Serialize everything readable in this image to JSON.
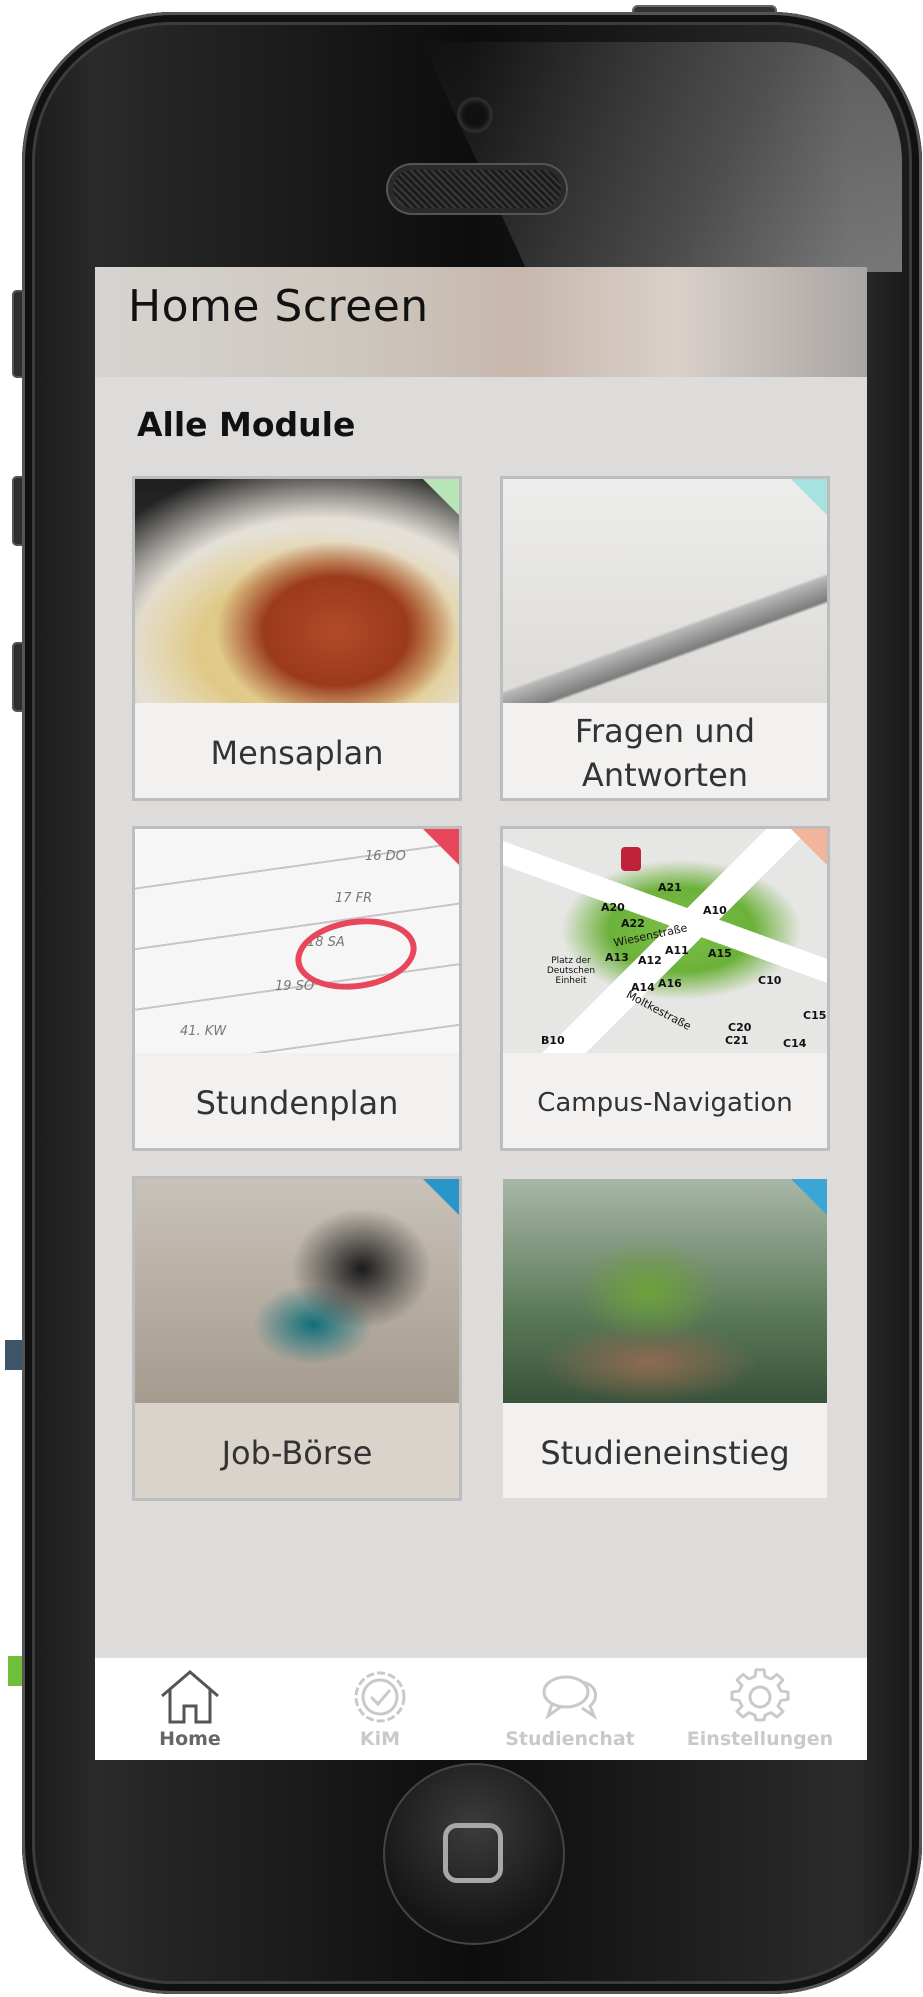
{
  "header": {
    "title": "Home Screen"
  },
  "section": {
    "title": "Alle Module"
  },
  "modules": [
    {
      "label": "Mensaplan",
      "image": "food-photo",
      "accent": "#b9e6b9"
    },
    {
      "label": "Fragen und Antworten",
      "image": "fountain-pen-photo",
      "accent": "#a6e2de"
    },
    {
      "label": "Stundenplan",
      "image": "calendar-photo",
      "accent": "#e8475b"
    },
    {
      "label": "Campus-Navigation",
      "image": "campus-map",
      "accent": "#f0b59a"
    },
    {
      "label": "Job-Börse",
      "image": "handshake-photo",
      "accent": "#2a95c9"
    },
    {
      "label": "Studieneinstieg",
      "image": "seedling-photo",
      "accent": "#3aa6d6"
    }
  ],
  "calendar": {
    "days": [
      "16 DO",
      "17 FR",
      "18 SA",
      "19 SO",
      "41. KW"
    ]
  },
  "map": {
    "labels": [
      "A21",
      "A20",
      "A22",
      "A10",
      "A13",
      "A12",
      "A11",
      "A15",
      "A14",
      "A16",
      "C10",
      "C20",
      "C21",
      "C14",
      "C15",
      "B10",
      "Wiesenstraße",
      "Moltkestraße",
      "Platz der Deutschen Einheit"
    ]
  },
  "tabbar": {
    "items": [
      {
        "label": "Home",
        "icon": "home-icon",
        "active": true
      },
      {
        "label": "KiM",
        "icon": "badge-check-icon",
        "active": false
      },
      {
        "label": "Studienchat",
        "icon": "chat-bubbles-icon",
        "active": false
      },
      {
        "label": "Einstellungen",
        "icon": "gear-icon",
        "active": false
      }
    ]
  }
}
